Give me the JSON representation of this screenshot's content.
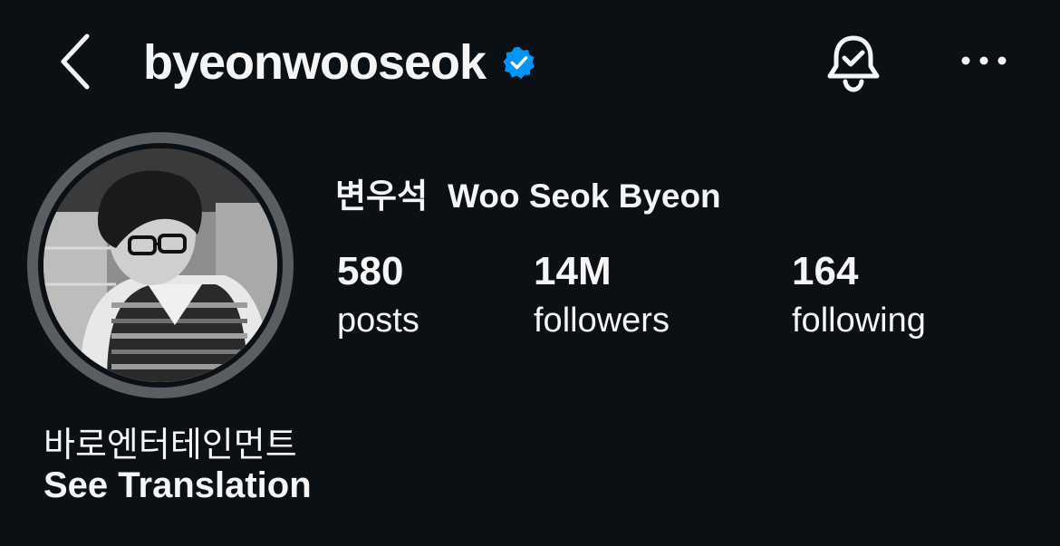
{
  "header": {
    "username": "byeonwooseok",
    "verified": true,
    "icons": {
      "back": "chevron-left-icon",
      "verified": "verified-badge-icon",
      "notifications": "bell-check-icon",
      "more": "more-horizontal-icon"
    }
  },
  "profile": {
    "avatar": "profile-photo",
    "full_name_korean": "변우석",
    "full_name_english": "Woo Seok Byeon",
    "stats": [
      {
        "value": "580",
        "label": "posts"
      },
      {
        "value": "14M",
        "label": "followers"
      },
      {
        "value": "164",
        "label": "following"
      }
    ],
    "bio": "바로엔터테인먼트",
    "translate_label": "See Translation"
  },
  "colors": {
    "background": "#0b1014",
    "text": "#f5f5f5",
    "verified_blue": "#0095f6",
    "avatar_ring": "#5a5e63"
  }
}
